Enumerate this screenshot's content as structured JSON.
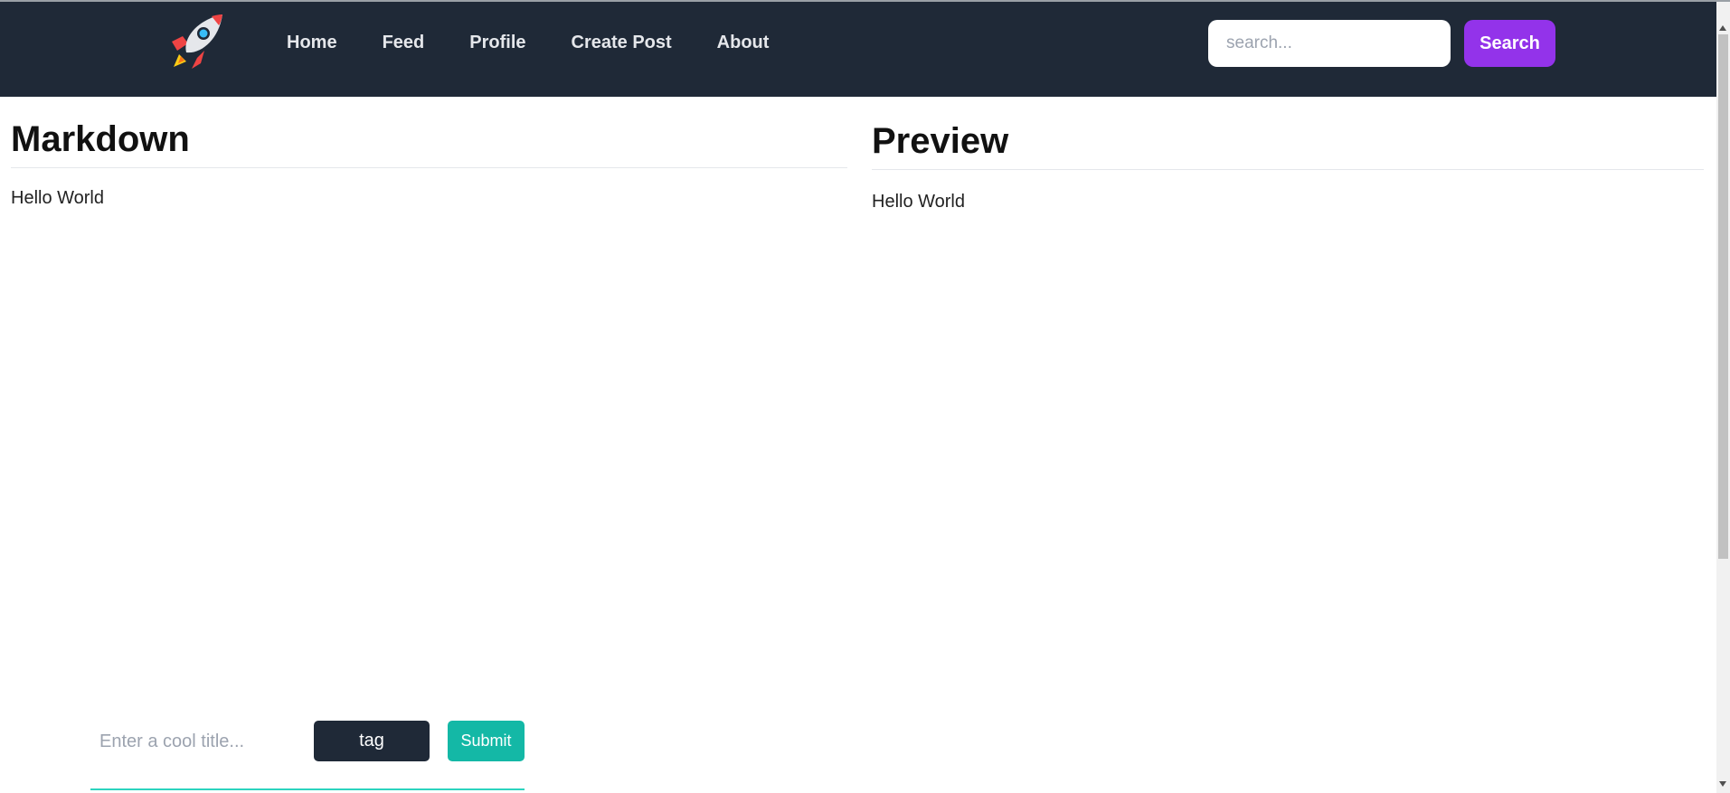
{
  "nav": {
    "logo_icon": "rocket-icon",
    "links": [
      "Home",
      "Feed",
      "Profile",
      "Create Post",
      "About"
    ],
    "search_placeholder": "search...",
    "search_label": "Search"
  },
  "editor": {
    "title": "Markdown",
    "content": "Hello World"
  },
  "preview": {
    "title": "Preview",
    "content": "Hello World"
  },
  "form": {
    "title_placeholder": "Enter a cool title...",
    "tag_label": "tag",
    "submit_label": "Submit"
  },
  "colors": {
    "navbar": "#1f2937",
    "search_button": "#9333ea",
    "submit_button": "#14b8a6",
    "tag_button": "#1f2937"
  }
}
